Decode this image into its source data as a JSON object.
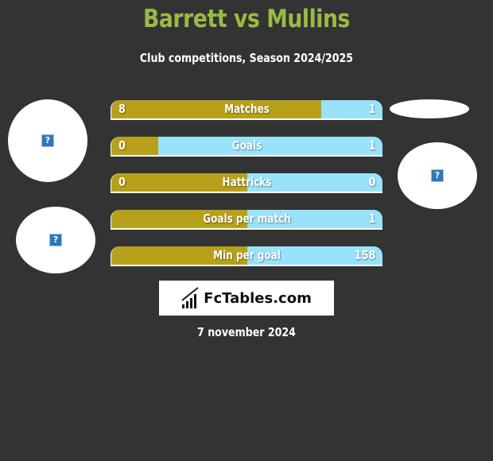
{
  "header": {
    "title": "Barrett vs Mullins",
    "subtitle": "Club competitions, Season 2024/2025"
  },
  "colors": {
    "left_player": "#b8a11a",
    "right_player": "#99e3fa",
    "title": "#99bb44",
    "background": "#333333"
  },
  "players": {
    "left": {
      "name": "Barrett",
      "avatar_icon": "broken-image-icon",
      "club_icon": "broken-image-icon"
    },
    "right": {
      "name": "Mullins",
      "avatar_icon": "broken-image-icon"
    }
  },
  "stats": [
    {
      "label": "Matches",
      "left": "8",
      "right": "1",
      "left_share": 0.774
    },
    {
      "label": "Goals",
      "left": "0",
      "right": "1",
      "left_share": 0.172
    },
    {
      "label": "Hattricks",
      "left": "0",
      "right": "0",
      "left_share": 0.5
    },
    {
      "label": "Goals per match",
      "left": "",
      "right": "1",
      "left_share": 0.5
    },
    {
      "label": "Min per goal",
      "left": "",
      "right": "158",
      "left_share": 0.5
    }
  ],
  "logo": {
    "text": "FcTables.com",
    "icon": "bar-chart-icon"
  },
  "footer": {
    "date": "7 november 2024"
  }
}
